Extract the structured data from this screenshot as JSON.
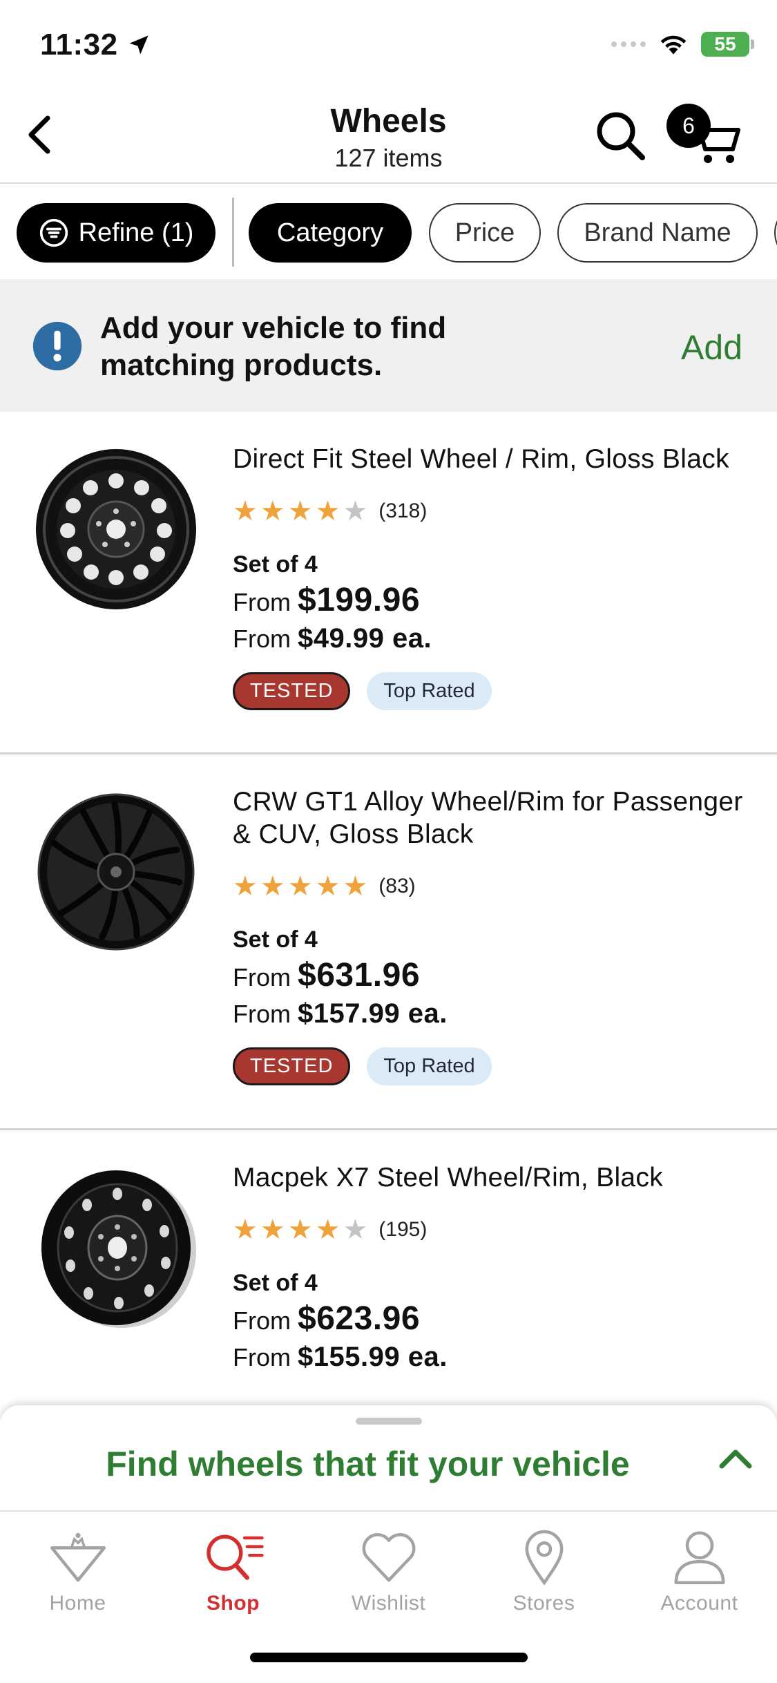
{
  "status_bar": {
    "time": "11:32",
    "battery": "55"
  },
  "header": {
    "title": "Wheels",
    "subtitle": "127 items",
    "cart_count": "6"
  },
  "filters": [
    {
      "label": "Refine (1)",
      "style": "dark",
      "icon": "sliders-icon"
    },
    {
      "label": "Category",
      "style": "dark"
    },
    {
      "label": "Price",
      "style": "outline"
    },
    {
      "label": "Brand Name",
      "style": "outline"
    }
  ],
  "vehicle_banner": {
    "message": "Add your vehicle to find matching products.",
    "action": "Add"
  },
  "products": [
    {
      "name": "Direct Fit Steel Wheel / Rim, Gloss Black",
      "rating": 4,
      "reviews": "(318)",
      "set_label": "Set of 4",
      "from_label": "From",
      "set_price": "$199.96",
      "each_price": "$49.99 ea.",
      "badges": [
        "TESTED",
        "Top Rated"
      ]
    },
    {
      "name": "CRW GT1 Alloy Wheel/Rim for Passenger & CUV, Gloss Black",
      "rating": 5,
      "reviews": "(83)",
      "set_label": "Set of 4",
      "from_label": "From",
      "set_price": "$631.96",
      "each_price": "$157.99 ea.",
      "badges": [
        "TESTED",
        "Top Rated"
      ]
    },
    {
      "name": "Macpek X7 Steel Wheel/Rim, Black",
      "rating": 4,
      "reviews": "(195)",
      "set_label": "Set of 4",
      "from_label": "From",
      "set_price": "$623.96",
      "each_price": "$155.99 ea.",
      "badges": []
    }
  ],
  "drawer": {
    "text": "Find wheels that fit your vehicle"
  },
  "tabbar": [
    {
      "label": "Home",
      "icon": "home-icon",
      "active": false
    },
    {
      "label": "Shop",
      "icon": "shop-icon",
      "active": true
    },
    {
      "label": "Wishlist",
      "icon": "heart-icon",
      "active": false
    },
    {
      "label": "Stores",
      "icon": "location-pin-icon",
      "active": false
    },
    {
      "label": "Account",
      "icon": "account-icon",
      "active": false
    }
  ],
  "colors": {
    "accent_green": "#2e7d32",
    "active_red": "#d32f2f",
    "star": "#f0a23a",
    "tested_badge": "#a8382f",
    "top_rated_badge": "#dceaf6"
  }
}
